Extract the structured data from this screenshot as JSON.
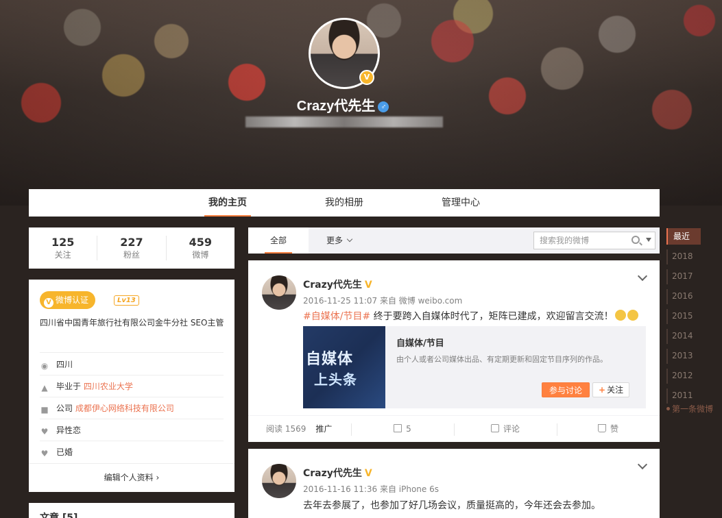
{
  "profile": {
    "name": "Crazy代先生",
    "verified_mark": "V",
    "gender_symbol": "♂",
    "bio_blurred": true
  },
  "nav": {
    "tabs": [
      {
        "label": "我的主页",
        "active": true
      },
      {
        "label": "我的相册",
        "active": false
      },
      {
        "label": "管理中心",
        "active": false
      }
    ]
  },
  "stats": [
    {
      "num": "125",
      "label": "关注"
    },
    {
      "num": "227",
      "label": "粉丝"
    },
    {
      "num": "459",
      "label": "微博"
    }
  ],
  "info": {
    "verify_label": "微博认证",
    "level": "Lv13",
    "intro": "四川省中国青年旅行社有限公司金牛分社 SEO主管",
    "location": "四川",
    "education_prefix": "毕业于",
    "education_school": "四川农业大学",
    "company_prefix": "公司",
    "company_name": "成都伊心网络科技有限公司",
    "orientation": "异性恋",
    "marital": "已婚",
    "edit_label": "编辑个人资料",
    "edit_arrow": "›"
  },
  "articles": {
    "label": "文章 [5]"
  },
  "feed": {
    "tab_all": "全部",
    "tab_more": "更多",
    "search_placeholder": "搜索我的微博",
    "post1": {
      "name": "Crazy代先生",
      "vmark": "V",
      "meta": "2016-11-25 11:07 来自 微博 weibo.com",
      "topic": "#自媒体/节目#",
      "text": " 终于要跨入自媒体时代了，矩阵已建成，欢迎留言交流！",
      "share_img_line1": "自媒体",
      "share_img_line2": "上头条",
      "share_title": "自媒体/节目",
      "share_desc": "由个人或者公司媒体出品、有定期更新和固定节目序列的作品。",
      "btn_discuss": "参与讨论",
      "btn_follow_plus": "+",
      "btn_follow": "关注",
      "reads": "阅读 1569",
      "promote": "推广",
      "forward_count": "5",
      "comment_label": "评论",
      "like_label": "赞"
    },
    "post2": {
      "name": "Crazy代先生",
      "vmark": "V",
      "meta": "2016-11-16 11:36 来自 iPhone 6s",
      "text": "去年去参展了，也参加了好几场会议，质量挺高的，今年还会去参加。"
    }
  },
  "timeline": {
    "items": [
      "最近",
      "2018",
      "2017",
      "2016",
      "2015",
      "2014",
      "2013",
      "2012",
      "2011"
    ],
    "first": "第一条微博"
  },
  "colors": {
    "accent": "#fa7d3c",
    "link": "#eb7350",
    "verified": "#f7b52c",
    "bg": "#2a2320"
  }
}
